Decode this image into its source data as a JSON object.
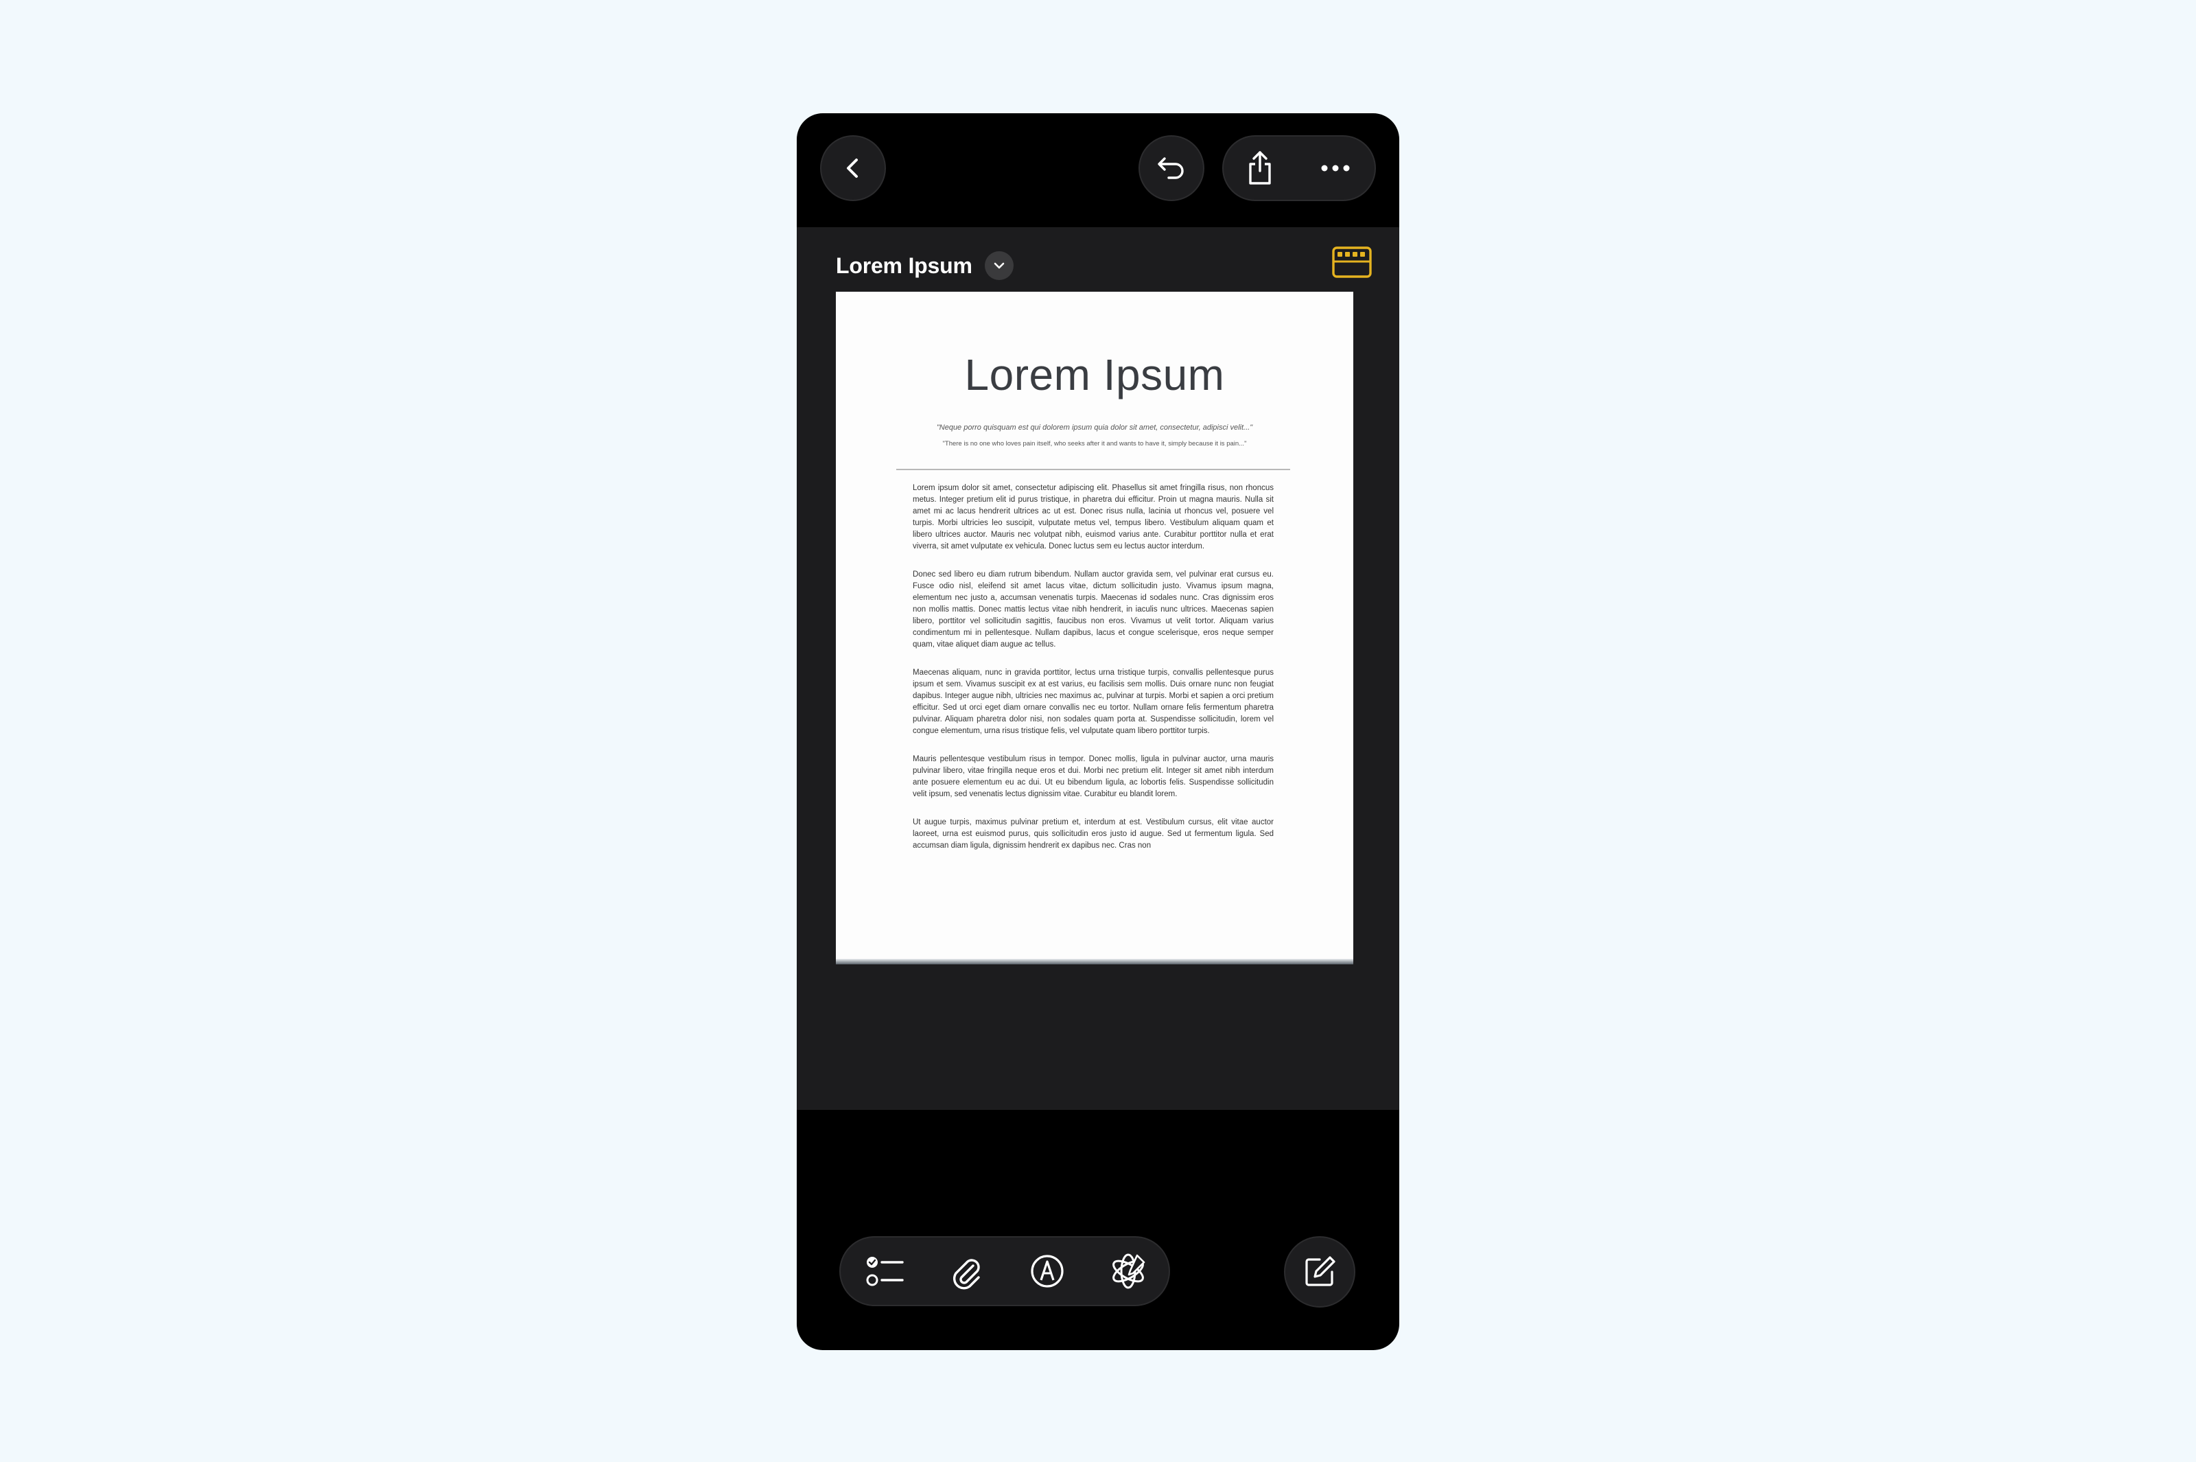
{
  "toolbar": {
    "back_icon": "chevron-left-icon",
    "undo_icon": "undo-arrow-icon",
    "share_icon": "share-icon",
    "more_icon": "ellipsis-icon"
  },
  "document": {
    "title": "Lorem Ipsum",
    "title_menu_icon": "chevron-down-icon",
    "keyboard_icon": "keyboard-icon",
    "accent_color": "#e5b320"
  },
  "scan": {
    "heading": "Lorem Ipsum",
    "quote": "\"Neque porro quisquam est qui dolorem ipsum quia dolor sit amet, consectetur, adipisci velit...\"",
    "quote_translation": "\"There is no one who loves pain itself, who seeks after it and wants to have it, simply because it is pain...\"",
    "paragraphs": [
      "Lorem ipsum dolor sit amet, consectetur adipiscing elit. Phasellus sit amet fringilla risus, non rhoncus metus. Integer pretium elit id purus tristique, in pharetra dui efficitur. Proin ut magna mauris. Nulla sit amet mi ac lacus hendrerit ultrices ac ut est. Donec risus nulla, lacinia ut rhoncus vel, posuere vel turpis. Morbi ultricies leo suscipit, vulputate metus vel, tempus libero. Vestibulum aliquam quam et libero ultrices auctor. Mauris nec volutpat nibh, euismod varius ante. Curabitur porttitor nulla et erat viverra, sit amet vulputate ex vehicula. Donec luctus sem eu lectus auctor interdum.",
      "Donec sed libero eu diam rutrum bibendum. Nullam auctor gravida sem, vel pulvinar erat cursus eu. Fusce odio nisl, eleifend sit amet lacus vitae, dictum sollicitudin justo. Vivamus ipsum magna, elementum nec justo a, accumsan venenatis turpis. Maecenas id sodales nunc. Cras dignissim eros non mollis mattis. Donec mattis lectus vitae nibh hendrerit, in iaculis nunc ultrices. Maecenas sapien libero, porttitor vel sollicitudin sagittis, faucibus non eros. Vivamus ut velit tortor. Aliquam varius condimentum mi in pellentesque. Nullam dapibus, lacus et congue scelerisque, eros neque semper quam, vitae aliquet diam augue ac tellus.",
      "Maecenas aliquam, nunc in gravida porttitor, lectus urna tristique turpis, convallis pellentesque purus ipsum et sem. Vivamus suscipit ex at est varius, eu facilisis sem mollis. Duis ornare nunc non feugiat dapibus. Integer augue nibh, ultricies nec maximus ac, pulvinar at turpis. Morbi et sapien a orci pretium efficitur. Sed ut orci eget diam ornare convallis nec eu tortor. Nullam ornare felis fermentum pharetra pulvinar. Aliquam pharetra dolor nisi, non sodales quam porta at. Suspendisse sollicitudin, lorem vel congue elementum, urna risus tristique felis, vel vulputate quam libero porttitor turpis.",
      "Mauris pellentesque vestibulum risus in tempor. Donec mollis, ligula in pulvinar auctor, urna mauris pulvinar libero, vitae fringilla neque eros et dui. Morbi nec pretium elit. Integer sit amet nibh interdum ante posuere elementum eu ac dui. Ut eu bibendum ligula, ac lobortis felis. Suspendisse sollicitudin velit ipsum, sed venenatis lectus dignissim vitae. Curabitur eu blandit lorem.",
      "Ut augue turpis, maximus pulvinar pretium et, interdum at est. Vestibulum cursus, elit vitae auctor laoreet, urna est euismod purus, quis sollicitudin eros justo id augue. Sed ut fermentum ligula. Sed accumsan diam ligula, dignissim hendrerit ex dapibus nec. Cras non"
    ]
  },
  "bottom_bar": {
    "checklist_icon": "checklist-icon",
    "attachment_icon": "paperclip-icon",
    "markup_icon": "markup-pen-icon",
    "writing_tools_icon": "writing-tools-icon",
    "compose_icon": "compose-icon"
  }
}
